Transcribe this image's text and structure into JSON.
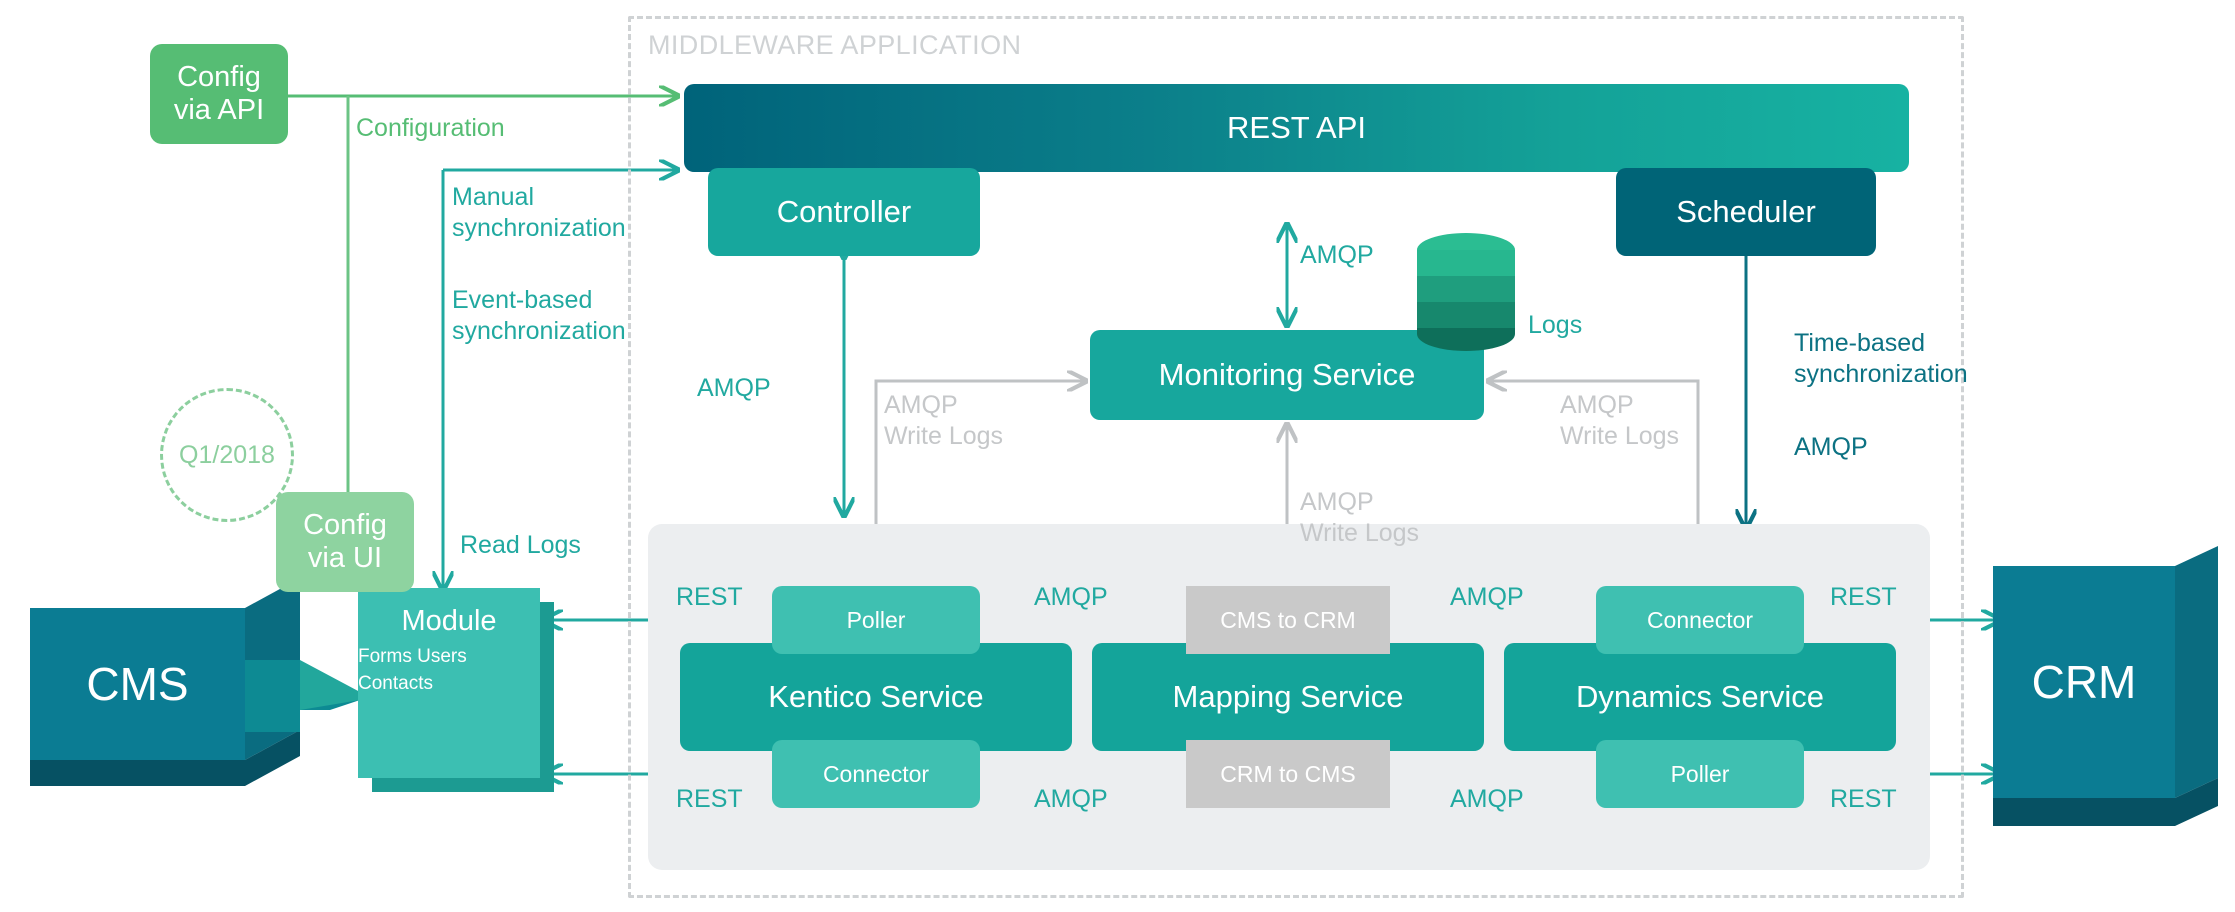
{
  "diagram": {
    "frame_title": "MIDDLEWARE APPLICATION",
    "milestone": "Q1/2018"
  },
  "external": {
    "cms": "CMS",
    "crm": "CRM",
    "module": {
      "title": "Module",
      "lines": "Forms\nUsers\nContacts"
    },
    "config_api": "Config\nvia API",
    "config_ui": "Config\nvia UI"
  },
  "middleware": {
    "rest_api": "REST API",
    "controller": "Controller",
    "scheduler": "Scheduler",
    "monitoring": "Monitoring Service",
    "logs_db": "Logs"
  },
  "services": [
    {
      "name": "Kentico Service",
      "top": "Poller",
      "bottom": "Connector"
    },
    {
      "name": "Mapping Service",
      "top": "CMS to CRM",
      "bottom": "CRM to CMS"
    },
    {
      "name": "Dynamics Service",
      "top": "Connector",
      "bottom": "Poller"
    }
  ],
  "edges": {
    "configuration": "Configuration",
    "manual_sync": "Manual\nsynchronization",
    "event_sync": "Event-based\nsynchronization",
    "read_logs": "Read Logs",
    "amqp_controller": "AMQP",
    "amqp_restapi": "AMQP",
    "amqp_left_write_logs": "AMQP\nWrite Logs",
    "amqp_right_write_logs": "AMQP\nWrite Logs",
    "amqp_center_write_logs": "AMQP\nWrite Logs",
    "time_sync": "Time-based\nsynchronization",
    "amqp_scheduler": "AMQP",
    "rest_cms_in": "REST",
    "rest_cms_out": "REST",
    "rest_crm_in": "REST",
    "rest_crm_out": "REST",
    "amqp_k_to_map": "AMQP",
    "amqp_map_to_d": "AMQP",
    "amqp_d_to_map": "AMQP",
    "amqp_map_to_k": "AMQP"
  },
  "colors": {
    "teal": "#17a79d",
    "dark_teal": "#006477",
    "light_teal": "#3fc0b1",
    "green": "#56bd74",
    "light_green": "#8ed3a0",
    "grey": "#c9c9c9",
    "panel": "#eceef0"
  }
}
